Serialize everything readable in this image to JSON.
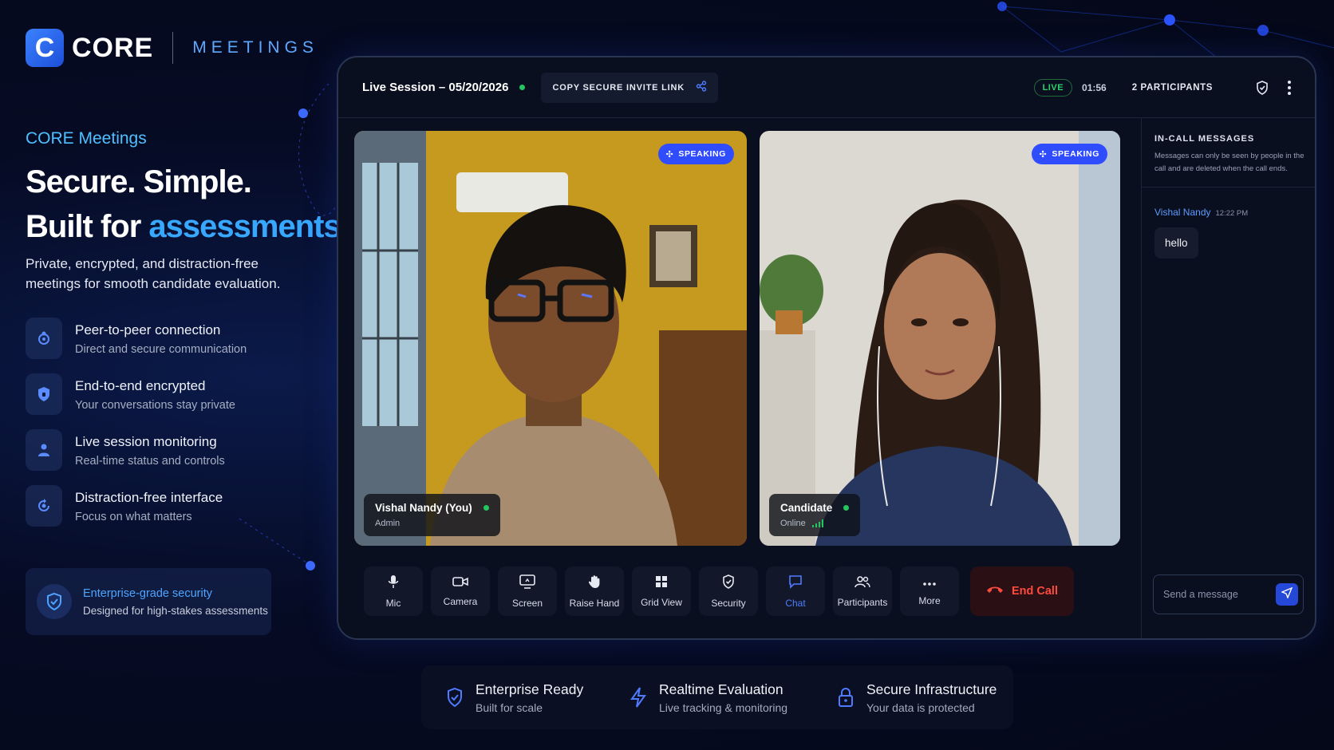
{
  "brand": {
    "logo_letter": "C",
    "name": "CORE",
    "product": "MEETINGS"
  },
  "hero": {
    "eyebrow": "CORE Meetings",
    "headline_line1": "Secure. Simple.",
    "headline_line2_prefix": "Built for ",
    "headline_line2_accent": "assessments.",
    "lead": "Private, encrypted, and distraction-free meetings for smooth candidate evaluation."
  },
  "features": [
    {
      "icon": "peer-connection-icon",
      "title": "Peer-to-peer connection",
      "subtitle": "Direct and secure communication"
    },
    {
      "icon": "encryption-shield-icon",
      "title": "End-to-end encrypted",
      "subtitle": "Your conversations stay private"
    },
    {
      "icon": "monitoring-icon",
      "title": "Live session monitoring",
      "subtitle": "Real-time status and controls"
    },
    {
      "icon": "focus-icon",
      "title": "Distraction-free interface",
      "subtitle": "Focus on what matters"
    }
  ],
  "security_card": {
    "title": "Enterprise-grade security",
    "subtitle": "Designed for high-stakes assessments"
  },
  "meeting": {
    "session_title": "Live Session – 05/20/2026",
    "invite_label": "COPY SECURE INVITE LINK",
    "live_label": "LIVE",
    "timer": "01:56",
    "participants_label": "2 PARTICIPANTS",
    "speaking_label": "SPEAKING",
    "tiles": [
      {
        "name": "Vishal Nandy (You)",
        "role": "Admin"
      },
      {
        "name": "Candidate",
        "role": "Online"
      }
    ]
  },
  "controls": [
    {
      "icon": "mic-icon",
      "label": "Mic"
    },
    {
      "icon": "camera-icon",
      "label": "Camera"
    },
    {
      "icon": "screen-share-icon",
      "label": "Screen"
    },
    {
      "icon": "hand-icon",
      "label": "Raise Hand"
    },
    {
      "icon": "grid-icon",
      "label": "Grid View"
    },
    {
      "icon": "security-icon",
      "label": "Security"
    },
    {
      "icon": "chat-icon",
      "label": "Chat",
      "active": true
    },
    {
      "icon": "participants-icon",
      "label": "Participants"
    },
    {
      "icon": "more-icon",
      "label": "More"
    }
  ],
  "end_call_label": "End Call",
  "chat": {
    "title": "IN-CALL MESSAGES",
    "note": "Messages can only be seen by people in the call and are deleted when the call ends.",
    "messages": [
      {
        "sender": "Vishal Nandy",
        "time": "12:22 PM",
        "text": "hello"
      }
    ],
    "input_placeholder": "Send a message"
  },
  "strip": [
    {
      "icon": "shield-check-icon",
      "title": "Enterprise Ready",
      "subtitle": "Built for scale"
    },
    {
      "icon": "lightning-icon",
      "title": "Realtime Evaluation",
      "subtitle": "Live tracking & monitoring"
    },
    {
      "icon": "lock-icon",
      "title": "Secure Infrastructure",
      "subtitle": "Your data is protected"
    }
  ],
  "colors": {
    "accent": "#38a8ff",
    "brand_blue": "#2f4dff",
    "live_green": "#22c55e",
    "end_call_red": "#ff4a3d"
  }
}
